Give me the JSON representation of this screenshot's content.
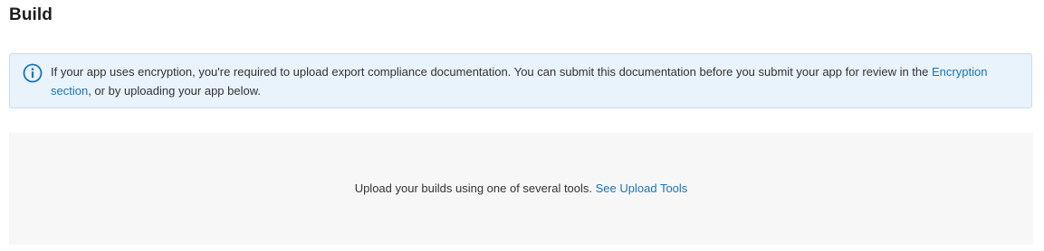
{
  "section": {
    "title": "Build"
  },
  "banner": {
    "icon": "info-icon",
    "text_before": "If your app uses encryption, you're required to upload export compliance documentation. You can submit this documentation before you submit your app for review in the ",
    "link_label": "Encryption section",
    "text_after": ", or by uploading your app below."
  },
  "upload": {
    "text": "Upload your builds using one of several tools. ",
    "link_label": "See Upload Tools"
  },
  "colors": {
    "banner_bg": "#e9f3fb",
    "banner_border": "#c3dbee",
    "link": "#1a73b8",
    "icon": "#1a73b8",
    "panel_bg": "#f7f7f7"
  }
}
